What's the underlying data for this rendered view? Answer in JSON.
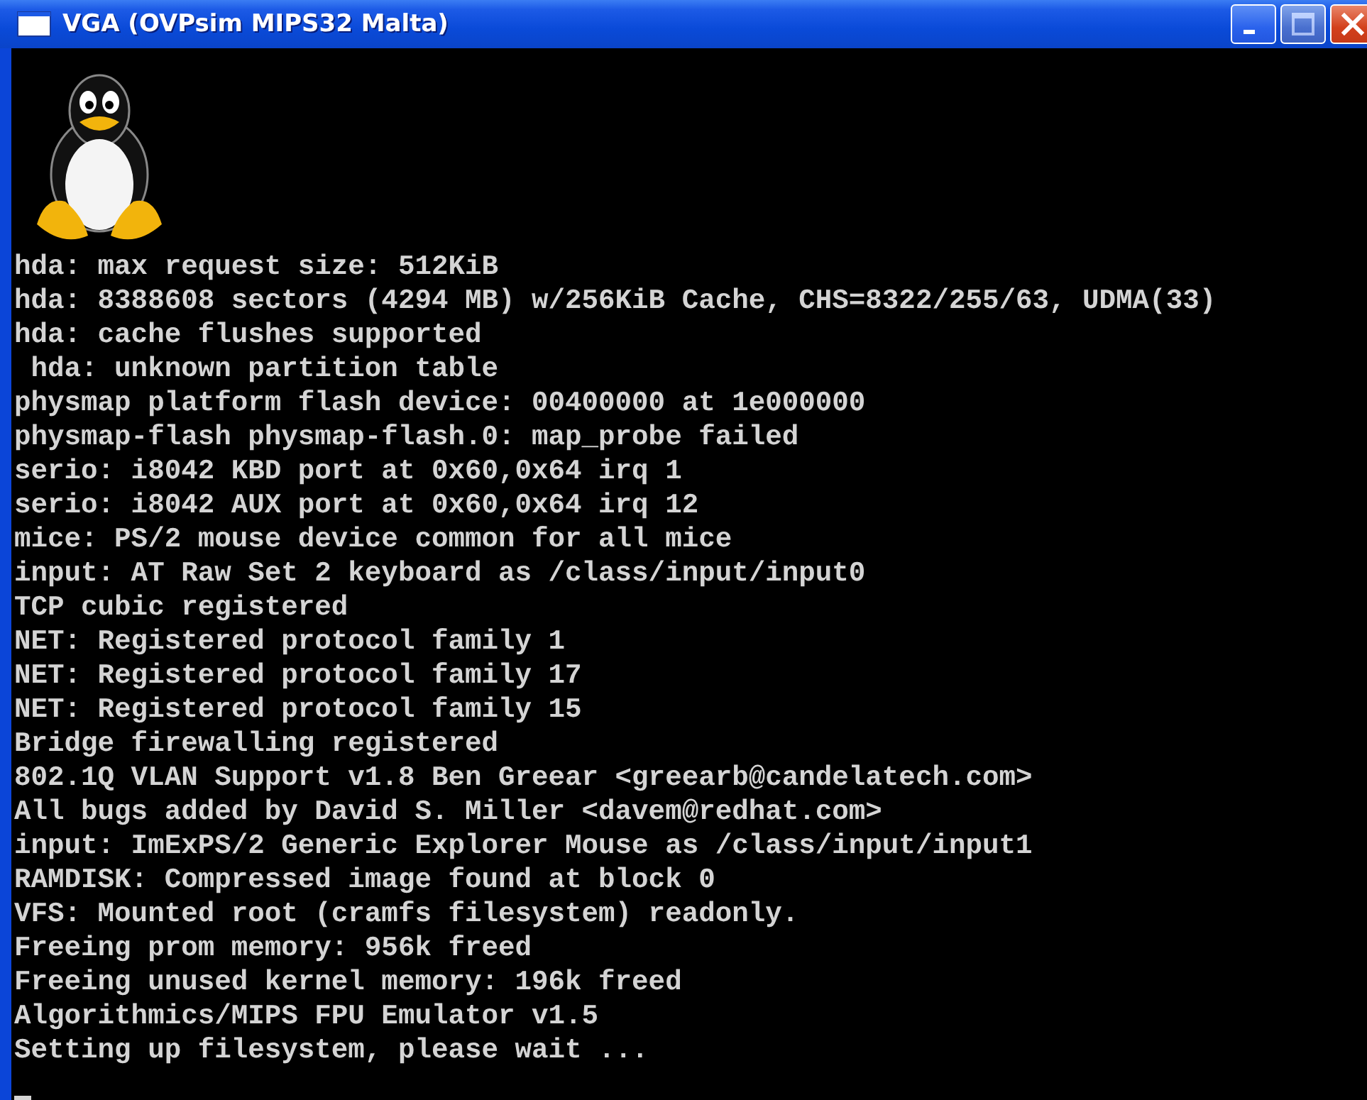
{
  "window": {
    "title": "VGA (OVPsim MIPS32 Malta)",
    "title_buttons": [
      {
        "kind": "minimize",
        "disabled": false
      },
      {
        "kind": "maximize",
        "disabled": true
      },
      {
        "kind": "close",
        "disabled": false
      }
    ]
  },
  "console": {
    "lines": [
      "hda: max request size: 512KiB",
      "hda: 8388608 sectors (4294 MB) w/256KiB Cache, CHS=8322/255/63, UDMA(33)",
      "hda: cache flushes supported",
      " hda: unknown partition table",
      "physmap platform flash device: 00400000 at 1e000000",
      "physmap-flash physmap-flash.0: map_probe failed",
      "serio: i8042 KBD port at 0x60,0x64 irq 1",
      "serio: i8042 AUX port at 0x60,0x64 irq 12",
      "mice: PS/2 mouse device common for all mice",
      "input: AT Raw Set 2 keyboard as /class/input/input0",
      "TCP cubic registered",
      "NET: Registered protocol family 1",
      "NET: Registered protocol family 17",
      "NET: Registered protocol family 15",
      "Bridge firewalling registered",
      "802.1Q VLAN Support v1.8 Ben Greear <greearb@candelatech.com>",
      "All bugs added by David S. Miller <davem@redhat.com>",
      "input: ImExPS/2 Generic Explorer Mouse as /class/input/input1",
      "RAMDISK: Compressed image found at block 0",
      "VFS: Mounted root (cramfs filesystem) readonly.",
      "Freeing prom memory: 956k freed",
      "Freeing unused kernel memory: 196k freed",
      "Algorithmics/MIPS FPU Emulator v1.5",
      "Setting up filesystem, please wait ..."
    ]
  }
}
